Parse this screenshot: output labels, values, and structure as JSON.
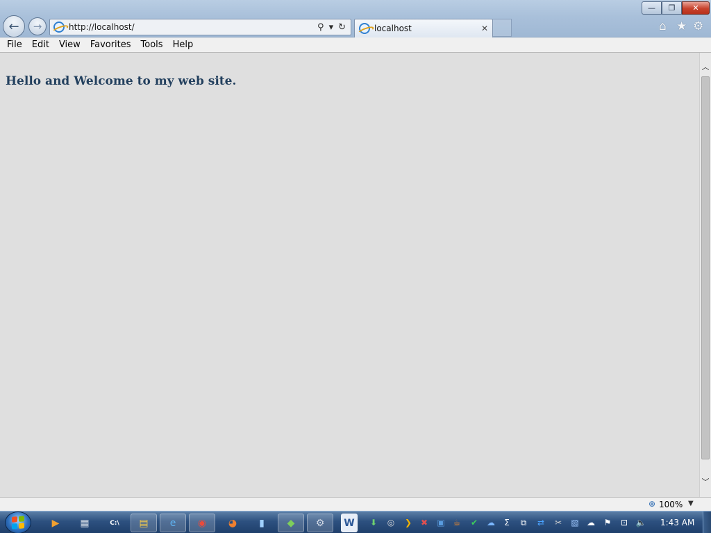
{
  "window": {
    "minimize_glyph": "—",
    "restore_glyph": "❐",
    "close_glyph": "✕"
  },
  "navigation": {
    "back_glyph": "←",
    "forward_glyph": "→"
  },
  "address_bar": {
    "url": "http://localhost/",
    "search_glyph": "⚲",
    "dropdown_glyph": "▾",
    "refresh_glyph": "↻"
  },
  "tabs": [
    {
      "title": "localhost",
      "close_glyph": "✕",
      "icon": "ie-icon"
    }
  ],
  "toolbar_right": {
    "home_glyph": "⌂",
    "favorites_glyph": "★",
    "tools_glyph": "⚙"
  },
  "menu": [
    "File",
    "Edit",
    "View",
    "Favorites",
    "Tools",
    "Help"
  ],
  "page": {
    "heading": "Hello and Welcome to my web site."
  },
  "scrollbar": {
    "up_glyph": "︿",
    "down_glyph": "﹀"
  },
  "status_bar": {
    "zoom_icon_glyph": "⊕",
    "zoom": "100%",
    "zoom_dropdown_glyph": "▼"
  },
  "taskbar": {
    "start_logo_colors": [
      "#f25022",
      "#7fba00",
      "#00a4ef",
      "#ffb900"
    ],
    "buttons": [
      {
        "name": "media-player",
        "glyph": "▶",
        "color": "#f0a030"
      },
      {
        "name": "calculator",
        "glyph": "▦",
        "color": "#cfd8e3"
      },
      {
        "name": "command-prompt",
        "glyph": "C:\\",
        "color": "#ffffff"
      },
      {
        "name": "file-explorer",
        "glyph": "▤",
        "color": "#f2c94c"
      },
      {
        "name": "internet-explorer",
        "glyph": "e",
        "color": "#5fb4f2"
      },
      {
        "name": "chrome",
        "glyph": "◉",
        "color": "#e94b3c"
      },
      {
        "name": "firefox",
        "glyph": "◕",
        "color": "#f08030"
      },
      {
        "name": "usb-tool",
        "glyph": "▮",
        "color": "#9fd0ff"
      },
      {
        "name": "green-app",
        "glyph": "◆",
        "color": "#7ecf5b"
      },
      {
        "name": "control-tool",
        "glyph": "⚙",
        "color": "#d0d8e4"
      },
      {
        "name": "word",
        "glyph": "W",
        "color": "#2b5797"
      }
    ],
    "tray": [
      {
        "name": "download",
        "glyph": "⬇",
        "color": "#6fd16f"
      },
      {
        "name": "disc",
        "glyph": "◎",
        "color": "#d9d9d9"
      },
      {
        "name": "plex",
        "glyph": "❯",
        "color": "#f5b400"
      },
      {
        "name": "xl-app",
        "glyph": "✖",
        "color": "#e05050"
      },
      {
        "name": "news",
        "glyph": "▣",
        "color": "#5a9de0"
      },
      {
        "name": "java",
        "glyph": "☕",
        "color": "#f08a2a"
      },
      {
        "name": "check",
        "glyph": "✔",
        "color": "#3dcf5a"
      },
      {
        "name": "cloud-drive",
        "glyph": "☁",
        "color": "#7ab6ff"
      },
      {
        "name": "sigma",
        "glyph": "Σ",
        "color": "#ffffff"
      },
      {
        "name": "windows-app",
        "glyph": "⧉",
        "color": "#ffffff"
      },
      {
        "name": "teamviewer",
        "glyph": "⇄",
        "color": "#4aa3ff"
      },
      {
        "name": "tools",
        "glyph": "✂",
        "color": "#d0d0d0"
      },
      {
        "name": "network-app",
        "glyph": "▧",
        "color": "#9fc8ff"
      },
      {
        "name": "onedrive",
        "glyph": "☁",
        "color": "#ffffff"
      },
      {
        "name": "action-center-flag",
        "glyph": "⚑",
        "color": "#ffffff"
      },
      {
        "name": "network",
        "glyph": "⊡",
        "color": "#ffffff"
      },
      {
        "name": "volume",
        "glyph": "🔈",
        "color": "#ffffff"
      }
    ],
    "clock": "1:43 AM"
  }
}
